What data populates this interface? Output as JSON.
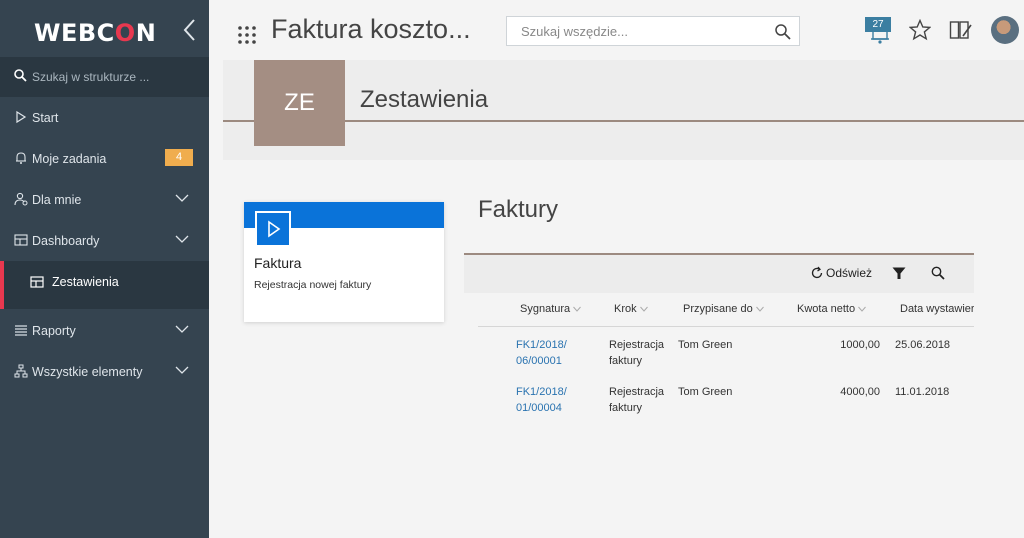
{
  "sidebar": {
    "logo": {
      "pre": "WEBC",
      "o": "O",
      "post": "N"
    },
    "search_placeholder": "Szukaj w strukturze ...",
    "items": [
      {
        "label": "Start"
      },
      {
        "label": "Moje zadania",
        "badge": "4"
      },
      {
        "label": "Dla mnie"
      },
      {
        "label": "Dashboardy"
      },
      {
        "label": "Zestawienia"
      },
      {
        "label": "Raporty"
      },
      {
        "label": "Wszystkie elementy"
      }
    ]
  },
  "topbar": {
    "app_title": "Faktura koszto...",
    "search_placeholder": "Szukaj wszędzie...",
    "notifications_count": "27"
  },
  "page": {
    "tile_initials": "ZE",
    "title": "Zestawienia"
  },
  "card": {
    "title": "Faktura",
    "description": "Rejestracja nowej faktury"
  },
  "list": {
    "title": "Faktury",
    "toolbar": {
      "refresh_label": "Odśwież"
    },
    "columns": [
      "Sygnatura",
      "Krok",
      "Przypisane do",
      "Kwota netto",
      "Data wystawier"
    ],
    "rows": [
      {
        "sig1": "FK1/2018/",
        "sig2": "06/00001",
        "krok1": "Rejestracja",
        "krok2": "faktury",
        "assigned": "Tom Green",
        "amount": "1000,00",
        "date": "25.06.2018"
      },
      {
        "sig1": "FK1/2018/",
        "sig2": "01/00004",
        "krok1": "Rejestracja",
        "krok2": "faktury",
        "assigned": "Tom Green",
        "amount": "4000,00",
        "date": "11.01.2018"
      }
    ]
  },
  "colors": {
    "sidebar_bg": "#354450",
    "accent_red": "#e8384f",
    "card_blue": "#0a73d9",
    "tile_bg": "#a48e83",
    "badge_orange": "#f0ad4e",
    "link_blue": "#2a73b0"
  }
}
